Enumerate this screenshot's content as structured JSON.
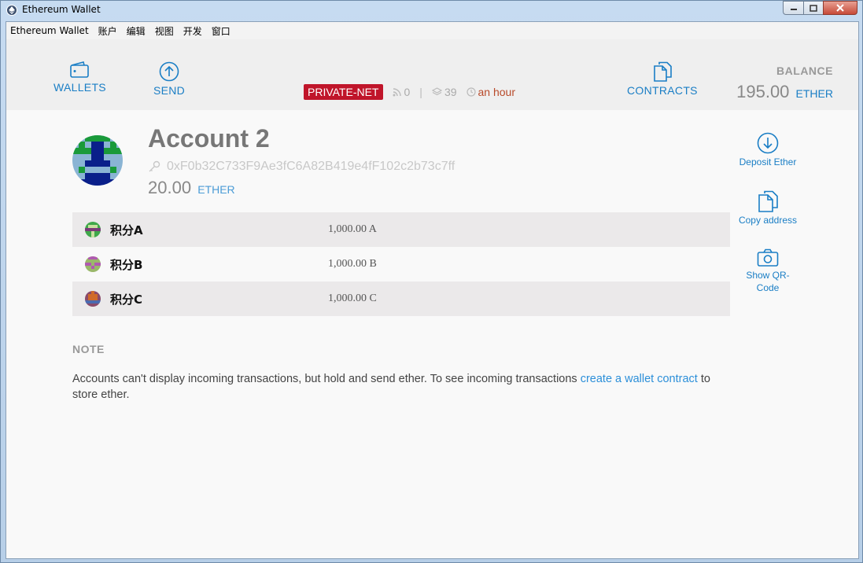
{
  "window": {
    "title": "Ethereum Wallet"
  },
  "menu": [
    "Ethereum Wallet",
    "账户",
    "编辑",
    "视图",
    "开发",
    "窗口"
  ],
  "nav": {
    "wallets": "WALLETS",
    "send": "SEND",
    "contracts": "CONTRACTS"
  },
  "status": {
    "network": "PRIVATE-NET",
    "peers": "0",
    "separator": "|",
    "blocks": "39",
    "time": "an hour"
  },
  "balance": {
    "label": "BALANCE",
    "value": "195.00",
    "unit": "ETHER"
  },
  "account": {
    "name": "Account 2",
    "address": "0xF0b32C733F9Ae3fC6A82B419e4fF102c2b73c7ff",
    "balance": "20.00",
    "unit": "ETHER"
  },
  "tokens": [
    {
      "name": "积分A",
      "amount": "1,000.00 A"
    },
    {
      "name": "积分B",
      "amount": "1,000.00 B"
    },
    {
      "name": "积分C",
      "amount": "1,000.00 C"
    }
  ],
  "actions": {
    "deposit": "Deposit Ether",
    "copy": "Copy address",
    "qr": "Show QR-Code"
  },
  "note": {
    "title": "NOTE",
    "text_before": "Accounts can't display incoming transactions, but hold and send ether. To see incoming transactions ",
    "link": "create a wallet contract",
    "text_after": " to store ether."
  },
  "colors": {
    "accent": "#1a7ec5",
    "network_badge": "#c0152a",
    "time_text": "#b84a2a"
  }
}
